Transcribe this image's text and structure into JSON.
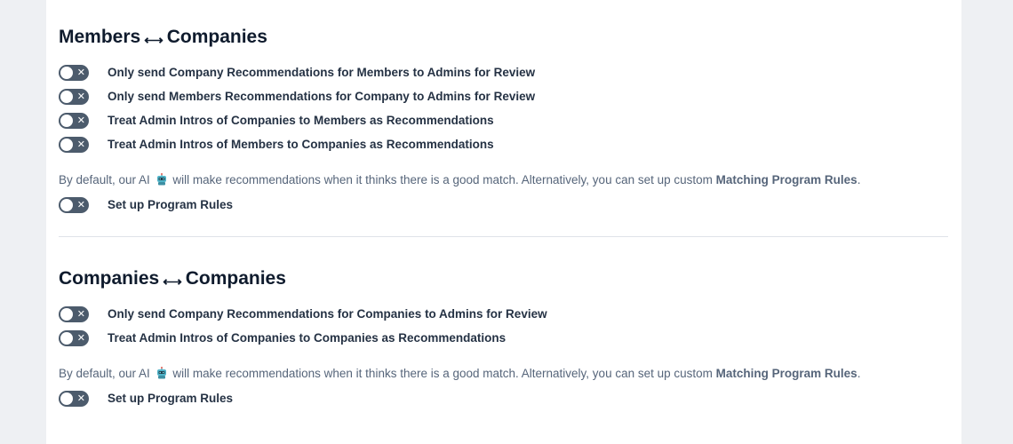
{
  "sections": [
    {
      "title_left": "Members",
      "arrow": "⟷",
      "title_right": "Companies",
      "toggles": [
        {
          "label": "Only send Company Recommendations for Members to Admins for Review"
        },
        {
          "label": "Only send Members Recommendations for Company to Admins for Review"
        },
        {
          "label": "Treat Admin Intros of Companies to Members as Recommendations"
        },
        {
          "label": "Treat Admin Intros of Members to Companies as Recommendations"
        }
      ],
      "info": {
        "prefix": "By default, our AI",
        "middle": "will make recommendations when it thinks there is a good match. Alternatively, you can set up custom",
        "link": "Matching Program Rules",
        "suffix": "."
      },
      "rules_label": "Set up Program Rules"
    },
    {
      "title_left": "Companies",
      "arrow": "⟷",
      "title_right": "Companies",
      "toggles": [
        {
          "label": "Only send Company Recommendations for Companies to Admins for Review"
        },
        {
          "label": "Treat Admin Intros of Companies to Companies as Recommendations"
        }
      ],
      "info": {
        "prefix": "By default, our AI",
        "middle": "will make recommendations when it thinks there is a good match. Alternatively, you can set up custom",
        "link": "Matching Program Rules",
        "suffix": "."
      },
      "rules_label": "Set up Program Rules"
    }
  ],
  "toggle_state": "off",
  "toggle_off_glyph": "✕",
  "icons": {
    "ai": "robot-icon",
    "toggle": "x-icon"
  },
  "colors": {
    "toggle_off": "#4c5b6c",
    "heading": "#0f1b2d",
    "label": "#253244",
    "muted_text": "#56657a"
  }
}
